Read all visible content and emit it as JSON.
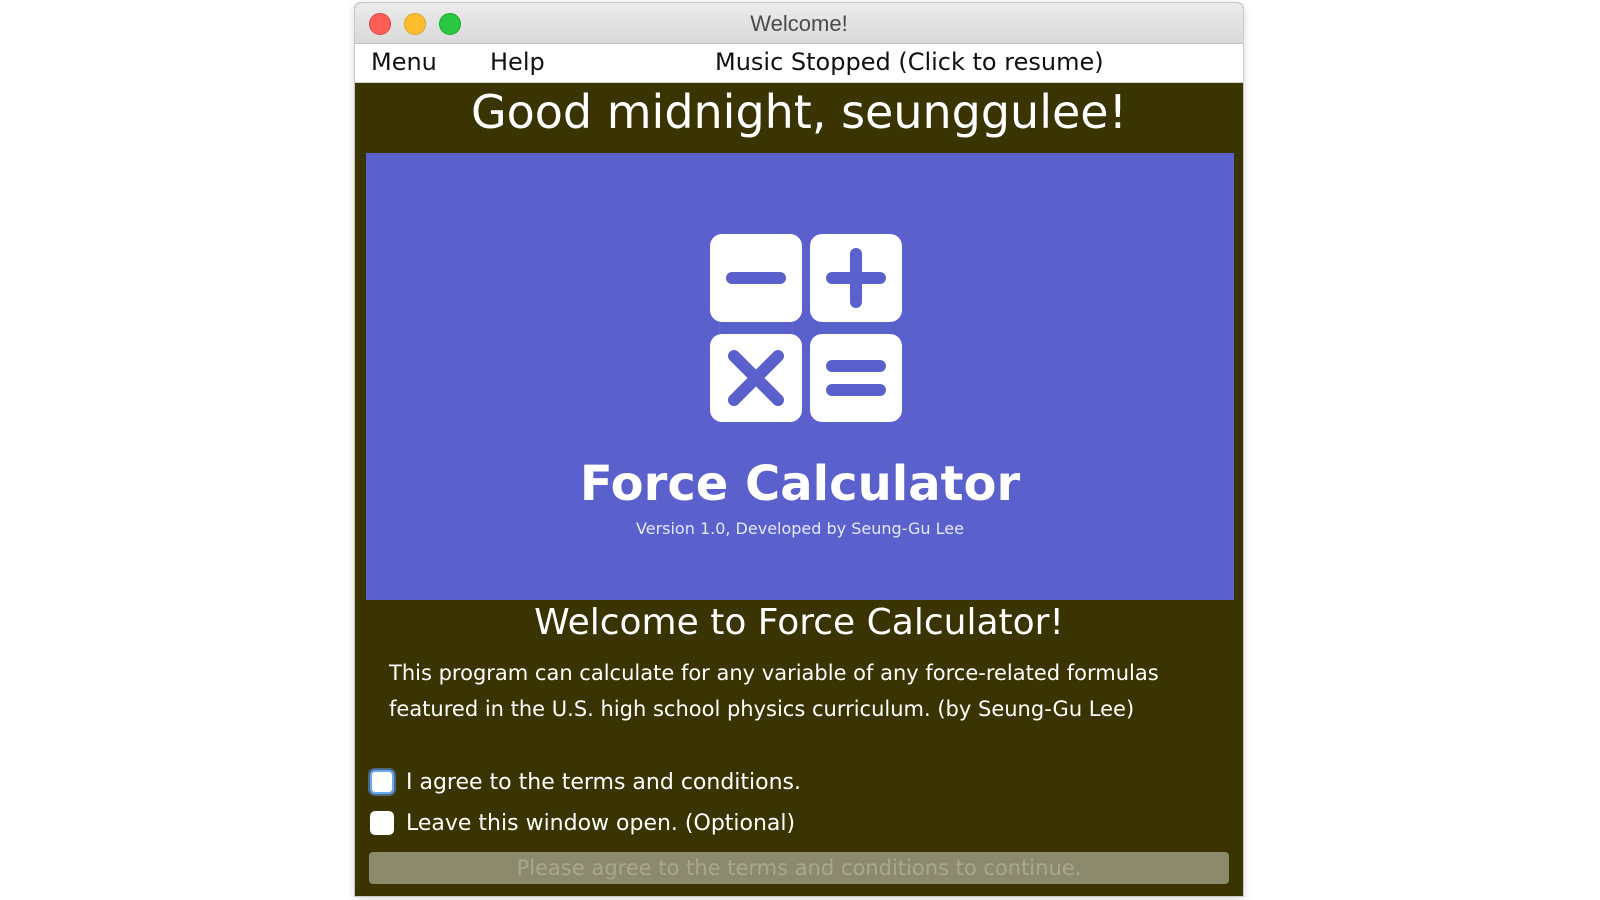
{
  "window": {
    "title": "Welcome!"
  },
  "menubar": {
    "menu_label": "Menu",
    "help_label": "Help",
    "music_label": "Music Stopped (Click to resume)"
  },
  "greeting": "Good midnight, seunggulee!",
  "banner": {
    "title": "Force Calculator",
    "version": "Version 1.0, Developed by Seung-Gu Lee",
    "icon": "calculator-operators-icon",
    "background_color": "#5a60cc"
  },
  "welcome": {
    "heading": "Welcome to Force Calculator!",
    "description": "This program can calculate for any variable of any force-related formulas featured in the U.S. high school physics curriculum. (by Seung-Gu Lee)"
  },
  "options": {
    "agree_label": "I agree to the terms and conditions.",
    "agree_checked": false,
    "leave_open_label": "Leave this window open. (Optional)",
    "leave_open_checked": false
  },
  "continue_button": {
    "label": "Please agree to the terms and conditions to continue.",
    "enabled": false
  },
  "colors": {
    "window_background": "#3a3302",
    "accent_banner": "#5a60cc"
  }
}
